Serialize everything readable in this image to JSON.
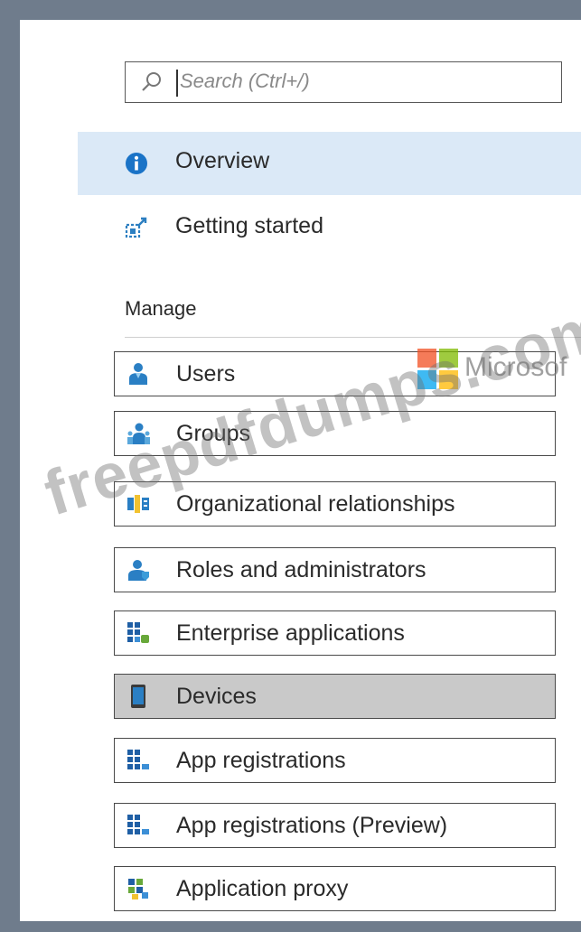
{
  "search": {
    "placeholder": "Search (Ctrl+/)"
  },
  "nav": {
    "overview_label": "Overview",
    "getting_started_label": "Getting started"
  },
  "manage": {
    "heading": "Manage",
    "items": [
      {
        "label": "Users",
        "icon": "user-icon"
      },
      {
        "label": "Groups",
        "icon": "groups-icon"
      },
      {
        "label": "Organizational relationships",
        "icon": "org-relationships-icon"
      },
      {
        "label": "Roles and administrators",
        "icon": "roles-icon"
      },
      {
        "label": "Enterprise applications",
        "icon": "enterprise-apps-icon"
      },
      {
        "label": "Devices",
        "icon": "device-icon",
        "selected": true
      },
      {
        "label": "App registrations",
        "icon": "app-registrations-icon"
      },
      {
        "label": "App registrations (Preview)",
        "icon": "app-registrations-preview-icon"
      },
      {
        "label": "Application proxy",
        "icon": "application-proxy-icon"
      }
    ]
  },
  "watermark": {
    "text": "freepdfdumps.com",
    "brand": "Microsof"
  },
  "colors": {
    "selected_bg": "#dbe9f7",
    "active_item_bg": "#c9c9c9",
    "icon_blue": "#1a73c7",
    "frame": "#6f7c8c"
  }
}
